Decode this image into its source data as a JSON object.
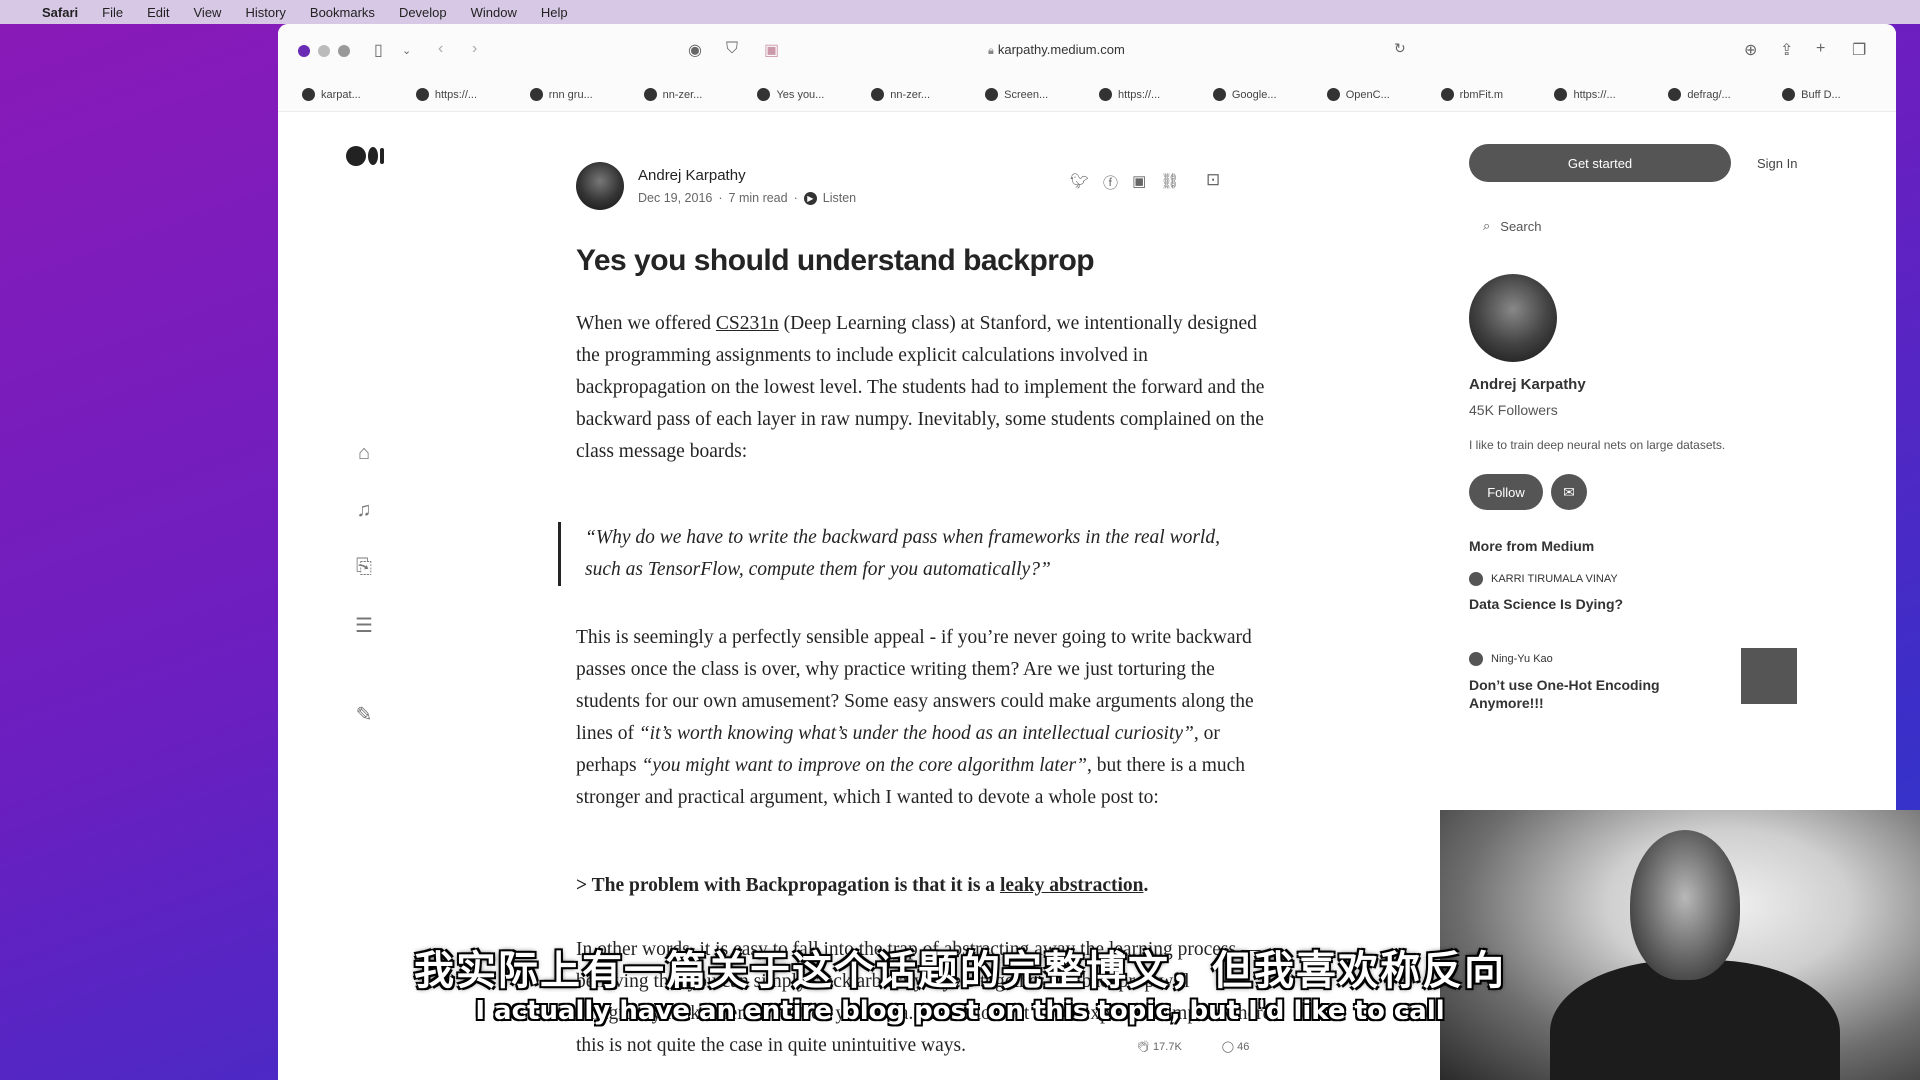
{
  "menubar": {
    "app": "Safari",
    "items": [
      "File",
      "Edit",
      "View",
      "History",
      "Bookmarks",
      "Develop",
      "Window",
      "Help"
    ]
  },
  "browser": {
    "url": "karpathy.medium.com",
    "favorites": [
      "karpat...",
      "https://...",
      "rnn gru...",
      "nn-zer...",
      "Yes you...",
      "nn-zer...",
      "Screen...",
      "https://...",
      "Google...",
      "OpenC...",
      "rbmFit.m",
      "https://...",
      "defrag/...",
      "Buff D..."
    ]
  },
  "article": {
    "author": "Andrej Karpathy",
    "date": "Dec 19, 2016",
    "read_time": "7 min read",
    "listen": "Listen",
    "title": "Yes you should understand backprop",
    "p1_a": "When we offered ",
    "p1_link": "CS231n",
    "p1_b": " (Deep Learning class) at Stanford, we intentionally designed the programming assignments to include explicit calculations involved in backpropagation on the lowest level. The students had to implement the forward and the backward pass of each layer in raw numpy. Inevitably, some students complained on the class message boards:",
    "quote": "“Why do we have to write the backward pass when frameworks in the real world, such as TensorFlow, compute them for you automatically?”",
    "p2_a": "This is seemingly a perfectly sensible appeal - if you’re never going to write backward passes once the class is over, why practice writing them? Are we just torturing the students for our own amusement? Some easy answers could make arguments along the lines of ",
    "p2_i1": "“it’s worth knowing what’s under the hood as an intellectual curiosity”",
    "p2_b": ", or perhaps ",
    "p2_i2": "“you might want to improve on the core algorithm later”",
    "p2_c": ", but there is a much stronger and practical argument, which I wanted to devote a whole post to:",
    "p3_a": "> The problem with Backpropagation is that it is a ",
    "p3_link": "leaky abstraction",
    "p3_b": ".",
    "p4": "In other words, it is easy to fall into the trap of abstracting away the learning process — believing that you can simply stack arbitrary layers together and backprop will “magically make them work” on your data. So lets look at a few explicit examples where this is not quite the case in quite unintuitive ways.",
    "claps": "17.7K",
    "responses": "46"
  },
  "sidebar": {
    "get_started": "Get started",
    "sign_in": "Sign In",
    "search": "Search",
    "name": "Andrej Karpathy",
    "followers": "45K Followers",
    "bio": "I like to train deep neural nets on large datasets.",
    "follow": "Follow",
    "more_title": "More from Medium",
    "rec1_author": "KARRI TIRUMALA VINAY",
    "rec1_title": "Data Science Is Dying?",
    "rec2_author": "Ning-Yu Kao",
    "rec2_title": "Don’t use One-Hot Encoding Anymore!!!"
  },
  "subtitles": {
    "chinese": "我实际上有一篇关于这个话题的完整博文，但我喜欢称反向",
    "english": "I actually have an entire blog post on this topic, but I'd like to call"
  },
  "colors": {
    "desktop_accent": "#7a1fc0",
    "button": "#555555"
  }
}
